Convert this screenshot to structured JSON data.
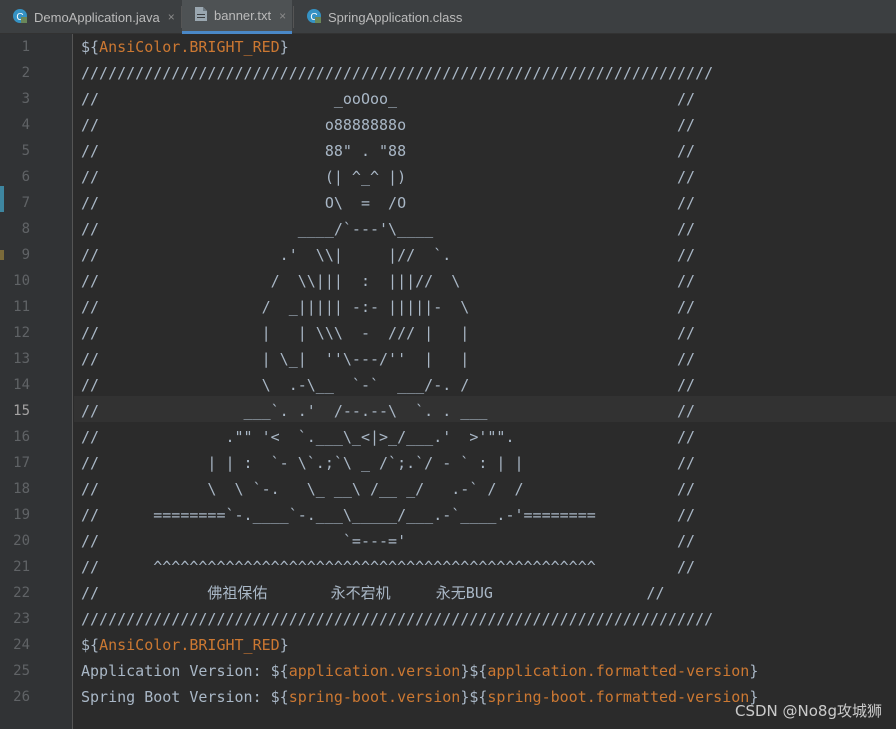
{
  "tabs": [
    {
      "label": "DemoApplication.java",
      "icon": "java-class-icon",
      "close": "×",
      "active": false
    },
    {
      "label": "banner.txt",
      "icon": "text-file-icon",
      "close": "×",
      "active": true
    },
    {
      "label": "SpringApplication.class",
      "icon": "java-class-icon",
      "close": "",
      "active": false
    }
  ],
  "line_numbers": [
    "1",
    "2",
    "3",
    "4",
    "5",
    "6",
    "7",
    "8",
    "9",
    "10",
    "11",
    "12",
    "13",
    "14",
    "15",
    "16",
    "17",
    "18",
    "19",
    "20",
    "21",
    "22",
    "23",
    "24",
    "25",
    "26"
  ],
  "current_line": "15",
  "code": {
    "l1": {
      "prefix": "${",
      "name": "AnsiColor.BRIGHT_RED",
      "suffix": "}"
    },
    "l2": "//////////////////////////////////////////////////////////////////////",
    "l3": "//                          _ooOoo_                               //",
    "l4": "//                         o8888888o                              //",
    "l5": "//                         88\" . \"88                              //",
    "l6": "//                         (| ^_^ |)                              //",
    "l7": "//                         O\\  =  /O                              //",
    "l8": "//                      ____/`---'\\____                           //",
    "l9": "//                    .'  \\\\|     |//  `.                         //",
    "l10": "//                   /  \\\\|||  :  |||//  \\                        //",
    "l11": "//                  /  _||||| -:- |||||-  \\                       //",
    "l12": "//                  |   | \\\\\\  -  /// |   |                       //",
    "l13": "//                  | \\_|  ''\\---/''  |   |                       //",
    "l14": "//                  \\  .-\\__  `-`  ___/-. /                       //",
    "l15": "//                ___`. .'  /--.--\\  `. . ___                     //",
    "l16": "//              .\"\" '<  `.___\\_<|>_/___.'  >'\"\".                  //",
    "l17": "//            | | :  `- \\`.;`\\ _ /`;.`/ - ` : | |                 //",
    "l18": "//            \\  \\ `-.   \\_ __\\ /__ _/   .-` /  /                 //",
    "l19": "//      ========`-.____`-.___\\_____/___.-`____.-'========         //",
    "l20": "//                           `=---='                              //",
    "l21": "//      ^^^^^^^^^^^^^^^^^^^^^^^^^^^^^^^^^^^^^^^^^^^^^^^^^         //",
    "l22": "//            佛祖保佑       永不宕机     永无BUG                 //",
    "l23": "//////////////////////////////////////////////////////////////////////",
    "l24": {
      "prefix": "${",
      "name": "AnsiColor.BRIGHT_RED",
      "suffix": "}"
    },
    "l25": {
      "label": "Application Version: ",
      "p1o": "${",
      "p1": "application.version",
      "p1c": "}",
      "p2o": "${",
      "p2": "application.formatted-version",
      "p2c": "}"
    },
    "l26": {
      "label": "Spring Boot Version: ",
      "p1o": "${",
      "p1": "spring-boot.version",
      "p1c": "}",
      "p2o": "${",
      "p2": "spring-boot.formatted-version",
      "p2c": "}"
    }
  },
  "watermark": "CSDN @No8g攻城狮",
  "colors": {
    "background": "#2b2b2b",
    "text": "#a9b7c6",
    "placeholder": "#cc7832",
    "tab_active_underline": "#4a88c7",
    "gutter_marker": "#3e86a0"
  }
}
